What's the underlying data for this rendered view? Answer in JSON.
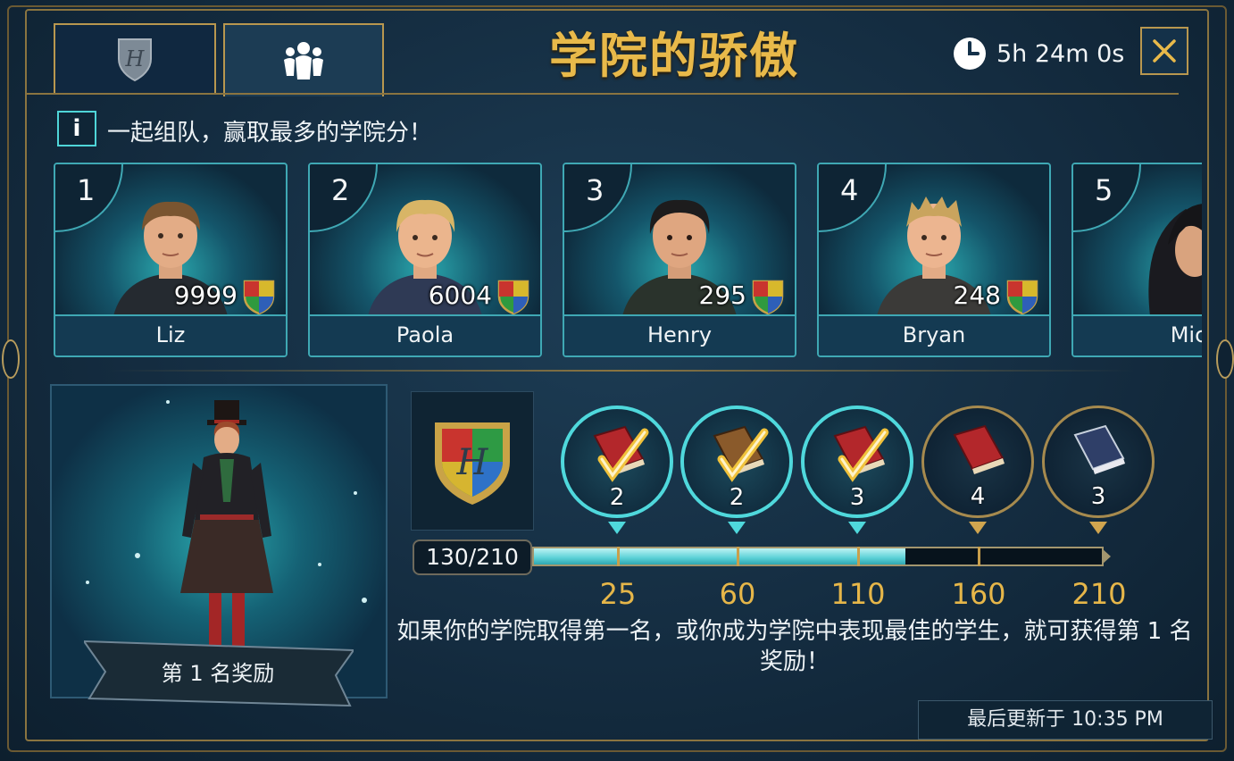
{
  "header": {
    "title": "学院的骄傲",
    "timer": "5h 24m 0s",
    "tabs": [
      {
        "id": "house",
        "icon": "house-crest-icon",
        "active": false
      },
      {
        "id": "team",
        "icon": "team-icon",
        "active": true
      }
    ],
    "close_icon": "close-icon"
  },
  "info": {
    "icon_label": "i",
    "text": "一起组队，赢取最多的学院分！"
  },
  "leaderboard": [
    {
      "rank": "1",
      "score": "9999",
      "name": "Liz"
    },
    {
      "rank": "2",
      "score": "6004",
      "name": "Paola"
    },
    {
      "rank": "3",
      "score": "295",
      "name": "Henry"
    },
    {
      "rank": "4",
      "score": "248",
      "name": "Bryan"
    },
    {
      "rank": "5",
      "score": "",
      "name": "Mic"
    }
  ],
  "reward": {
    "label": "第 1 名奖励"
  },
  "progress": {
    "current": 130,
    "max": 210,
    "label": "130/210",
    "milestones": [
      {
        "threshold": "25",
        "count": "2",
        "completed": true,
        "book_color": "#b3272b"
      },
      {
        "threshold": "60",
        "count": "2",
        "completed": true,
        "book_color": "#8a5a2b"
      },
      {
        "threshold": "110",
        "count": "3",
        "completed": true,
        "book_color": "#b3272b"
      },
      {
        "threshold": "160",
        "count": "4",
        "completed": false,
        "book_color": "#b3272b"
      },
      {
        "threshold": "210",
        "count": "3",
        "completed": false,
        "book_color": "#2f3f68"
      }
    ]
  },
  "description": "如果你的学院取得第一名，或你成为学院中表现最佳的学生，就可获得第 1 名奖励！",
  "footer": {
    "updated": "最后更新于 10:35 PM"
  },
  "colors": {
    "gold": "#e8b94a",
    "cyan": "#4fd8dc",
    "panel": "#143149"
  }
}
